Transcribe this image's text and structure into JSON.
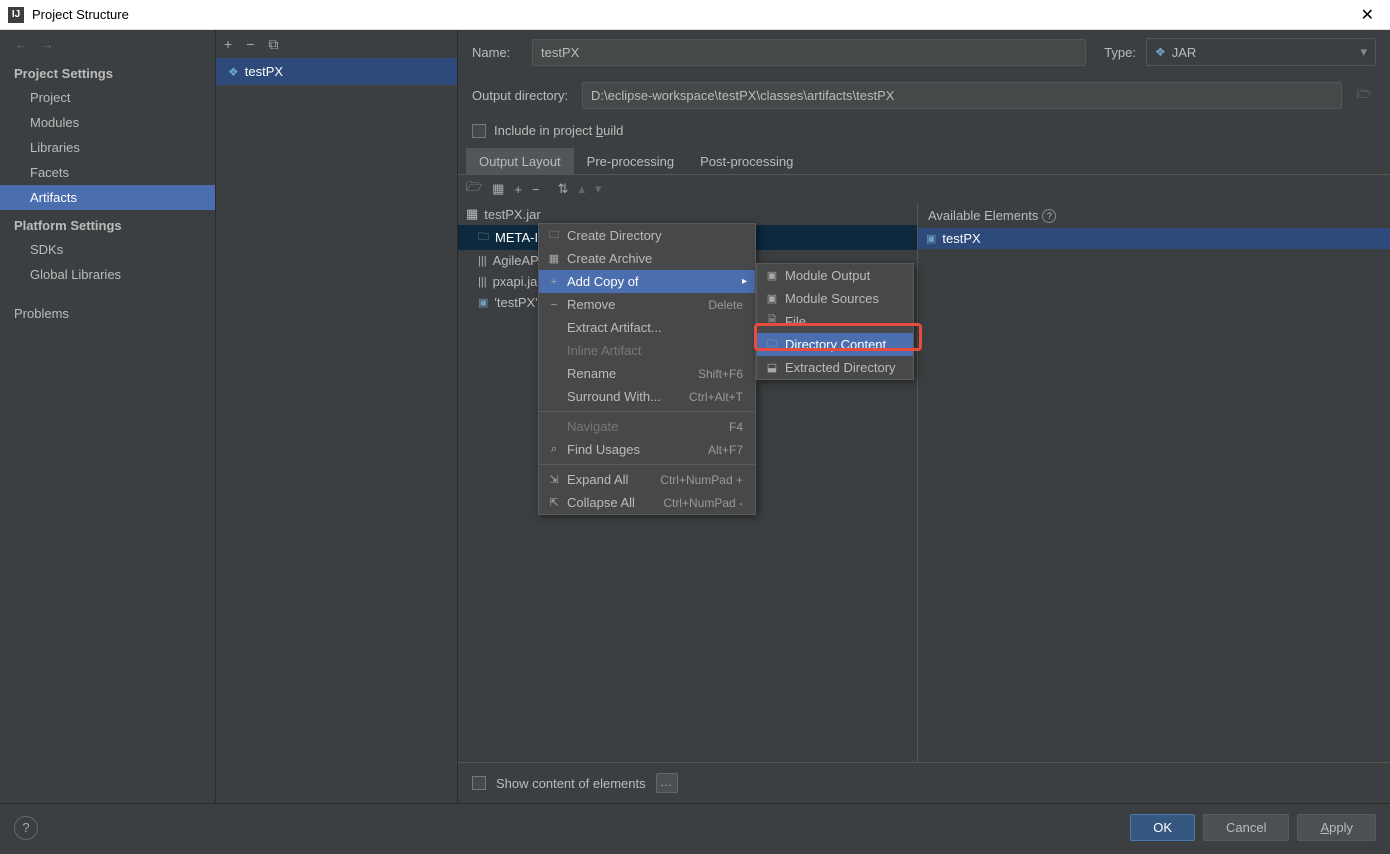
{
  "window": {
    "title": "Project Structure"
  },
  "sidebar": {
    "sections": [
      {
        "header": "Project Settings",
        "items": [
          "Project",
          "Modules",
          "Libraries",
          "Facets",
          "Artifacts"
        ]
      },
      {
        "header": "Platform Settings",
        "items": [
          "SDKs",
          "Global Libraries"
        ]
      }
    ],
    "problems": "Problems",
    "selected": "Artifacts"
  },
  "artifact_list": {
    "items": [
      "testPX"
    ]
  },
  "form": {
    "name_label": "Name:",
    "name_value": "testPX",
    "type_label": "Type:",
    "type_value": "JAR",
    "output_label": "Output directory:",
    "output_value": "D:\\eclipse-workspace\\testPX\\classes\\artifacts\\testPX",
    "include_label": "Include in project build"
  },
  "tabs": [
    "Output Layout",
    "Pre-processing",
    "Post-processing"
  ],
  "tree": {
    "root": "testPX.jar",
    "children": [
      {
        "label": "META-INF",
        "type": "folder",
        "selected": true
      },
      {
        "label": "AgileAP",
        "type": "lib"
      },
      {
        "label": "pxapi.ja",
        "type": "lib"
      },
      {
        "label": "'testPX'",
        "type": "module"
      }
    ]
  },
  "available": {
    "header": "Available Elements",
    "items": [
      "testPX"
    ]
  },
  "context_menu": {
    "items": [
      {
        "label": "Create Directory",
        "icon": "folder"
      },
      {
        "label": "Create Archive",
        "icon": "archive"
      },
      {
        "label": "Add Copy of",
        "icon": "plus",
        "selected": true,
        "submenu": true
      },
      {
        "label": "Remove",
        "icon": "minus",
        "shortcut": "Delete"
      },
      {
        "label": "Extract Artifact..."
      },
      {
        "label": "Inline Artifact",
        "disabled": true
      },
      {
        "label": "Rename",
        "shortcut": "Shift+F6"
      },
      {
        "label": "Surround With...",
        "shortcut": "Ctrl+Alt+T"
      }
    ],
    "items2": [
      {
        "label": "Navigate",
        "disabled": true,
        "shortcut": "F4"
      },
      {
        "label": "Find Usages",
        "icon": "search",
        "shortcut": "Alt+F7"
      }
    ],
    "items3": [
      {
        "label": "Expand All",
        "icon": "expand",
        "shortcut": "Ctrl+NumPad +"
      },
      {
        "label": "Collapse All",
        "icon": "collapse",
        "shortcut": "Ctrl+NumPad -"
      }
    ]
  },
  "submenu": {
    "items": [
      {
        "label": "Module Output",
        "icon": "module"
      },
      {
        "label": "Module Sources",
        "icon": "module"
      },
      {
        "label": "File",
        "icon": "file"
      },
      {
        "label": "Directory Content",
        "icon": "folder",
        "selected": true
      },
      {
        "label": "Extracted Directory",
        "icon": "extract"
      }
    ]
  },
  "bottom": {
    "show_content": "Show content of elements"
  },
  "footer": {
    "ok": "OK",
    "cancel": "Cancel",
    "apply": "Apply"
  }
}
